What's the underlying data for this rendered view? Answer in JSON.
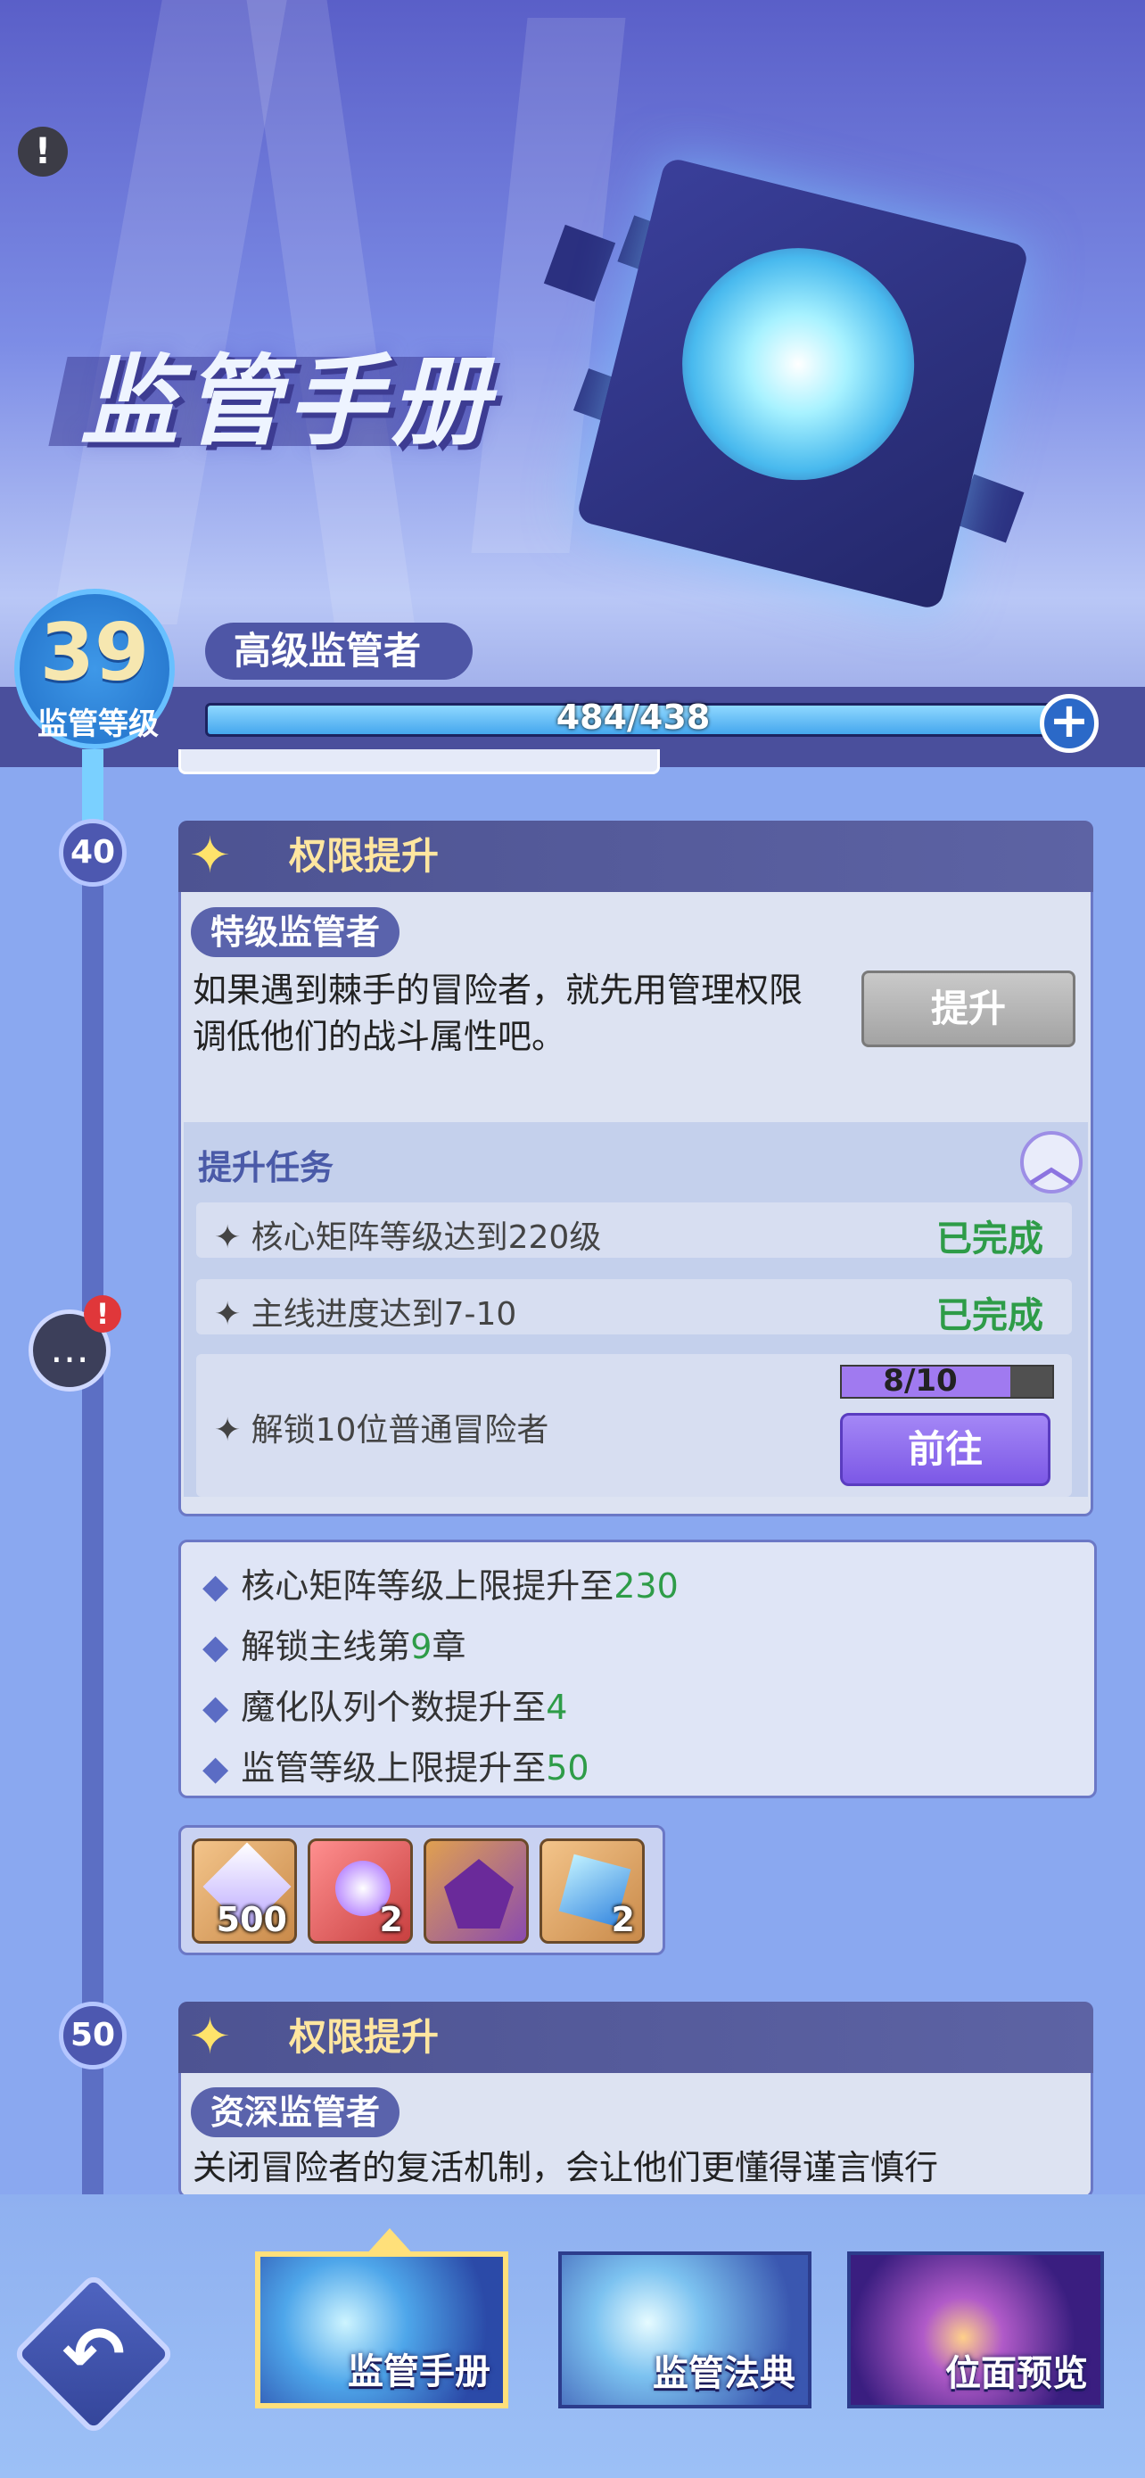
{
  "header": {
    "title": "监管手册",
    "warning_icon_glyph": "!",
    "level": "39",
    "level_label": "监管等级",
    "rank": "高级监管者",
    "xp_text": "484/438",
    "xp_fraction": 1.0,
    "plus_glyph": "+"
  },
  "section1": {
    "node_level": "40",
    "head_title": "权限提升",
    "rank_pill": "特级监管者",
    "description_line1": "如果遇到棘手的冒险者，就先用管理权限",
    "description_line2": "调低他们的战斗属性吧。",
    "upgrade_button": "提升",
    "tasks_title": "提升任务",
    "chevron_glyph": "︿",
    "tasks": [
      {
        "label": "✦ 核心矩阵等级达到220级",
        "status": "已完成"
      },
      {
        "label": "✦ 主线进度达到7-10",
        "status": "已完成"
      },
      {
        "label": "✦ 解锁10位普通冒险者",
        "status": ""
      }
    ],
    "task3_progress_text": "8/10",
    "task3_progress_fraction": 0.8,
    "go_button": "前往"
  },
  "rewards": [
    {
      "text": "核心矩阵等级上限提升至",
      "num": "230"
    },
    {
      "text": "解锁主线第",
      "num": "9",
      "suffix": "章"
    },
    {
      "text": "魔化队列个数提升至",
      "num": "4"
    },
    {
      "text": "监管等级上限提升至",
      "num": "50"
    }
  ],
  "items": [
    {
      "name": "star-crystal",
      "count": "500",
      "color": "#e9a86a"
    },
    {
      "name": "purple-orb",
      "count": "2",
      "color": "#e06060"
    },
    {
      "name": "dragon-card",
      "count": "",
      "color": "#d08a40"
    },
    {
      "name": "cube-card",
      "count": "2",
      "color": "#e9a86a"
    }
  ],
  "section2": {
    "node_level": "50",
    "head_title": "权限提升",
    "rank_pill": "资深监管者",
    "description_line1": "关闭冒险者的复活机制，会让他们更懂得谨言慎行"
  },
  "bottom_tabs": [
    {
      "label": "监管手册",
      "active": true
    },
    {
      "label": "监管法典",
      "active": false
    },
    {
      "label": "位面预览",
      "active": false
    }
  ],
  "back_glyph": "↶",
  "colors": {
    "accent_purple": "#7c58e6",
    "done_green": "#2e9c48",
    "header_bg": "#4a4f9c"
  }
}
